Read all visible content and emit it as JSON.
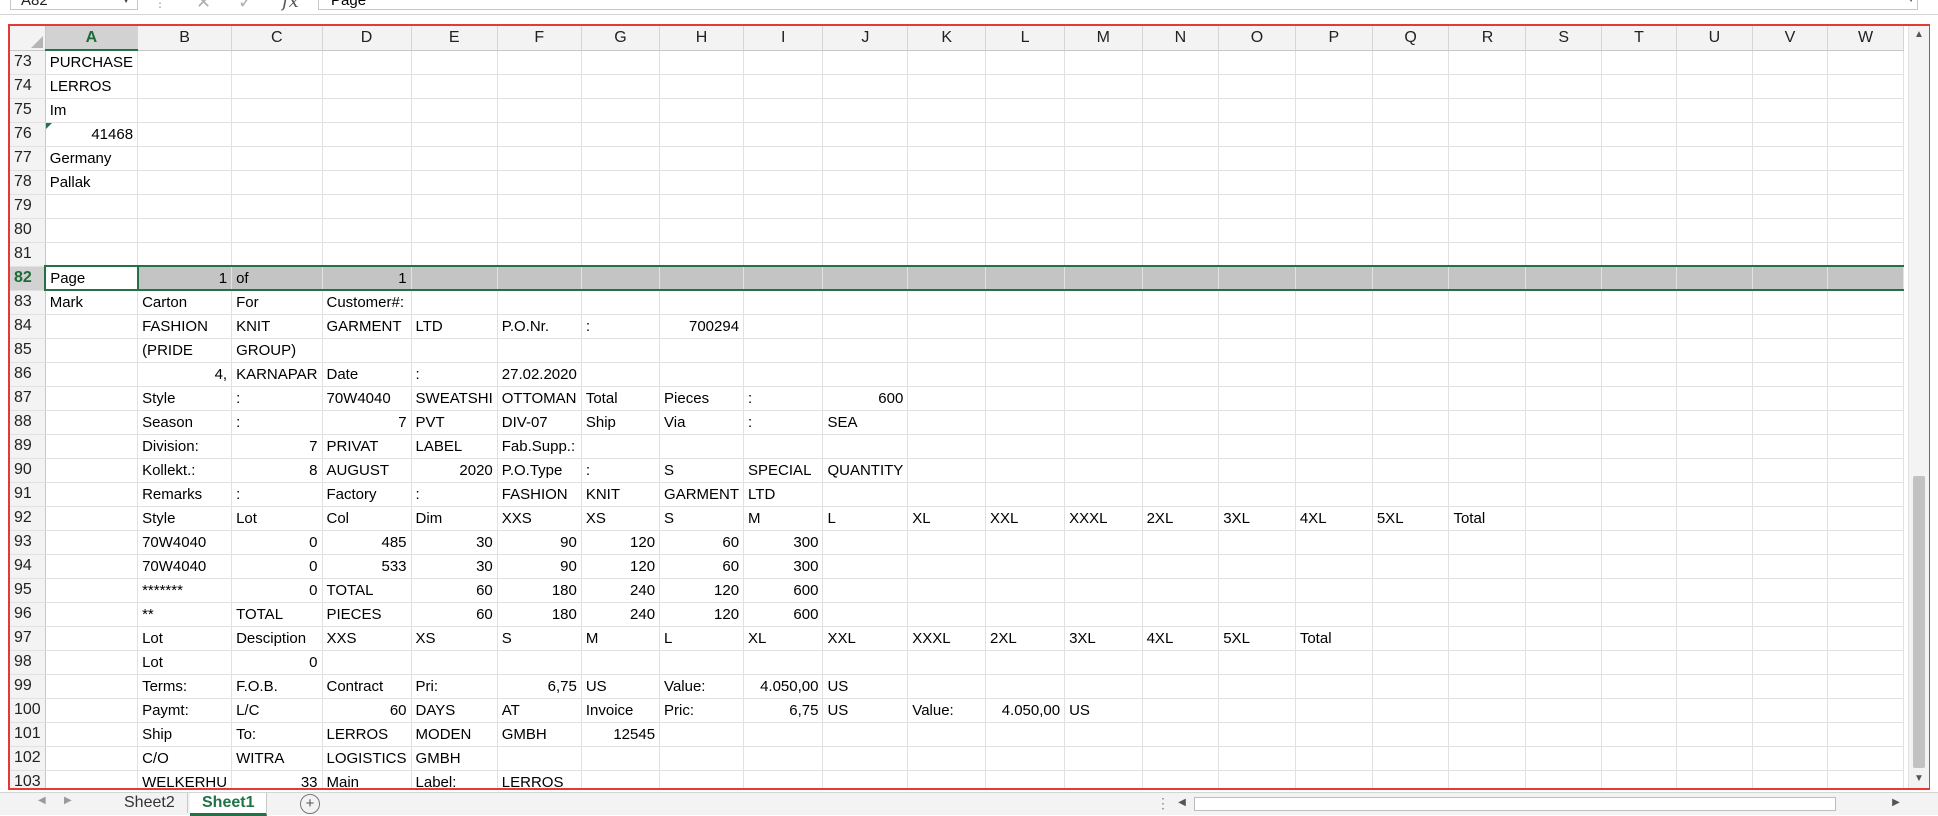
{
  "formula_bar": {
    "name_box": "A82",
    "formula": "Page"
  },
  "columns": [
    "A",
    "B",
    "C",
    "D",
    "E",
    "F",
    "G",
    "H",
    "I",
    "J",
    "K",
    "L",
    "M",
    "N",
    "O",
    "P",
    "Q",
    "R",
    "S",
    "T",
    "U",
    "V",
    "W"
  ],
  "selected_column": "A",
  "selected_row": "82",
  "rows": [
    {
      "n": "73",
      "cells": [
        "PURCHASE"
      ]
    },
    {
      "n": "74",
      "cells": [
        "LERROS"
      ]
    },
    {
      "n": "75",
      "cells": [
        "Im"
      ]
    },
    {
      "n": "76",
      "cells": [
        "41468"
      ]
    },
    {
      "n": "77",
      "cells": [
        "Germany"
      ]
    },
    {
      "n": "78",
      "cells": [
        "Pallak"
      ]
    },
    {
      "n": "79",
      "cells": []
    },
    {
      "n": "80",
      "cells": []
    },
    {
      "n": "81",
      "cells": []
    },
    {
      "n": "82",
      "cells": [
        "Page",
        "1",
        "of",
        "1"
      ]
    },
    {
      "n": "83",
      "cells": [
        "Mark",
        "Carton",
        "For",
        "Customer#:"
      ]
    },
    {
      "n": "84",
      "cells": [
        "",
        "FASHION",
        "KNIT",
        "GARMENT",
        "LTD",
        "P.O.Nr.",
        ":",
        "700294"
      ]
    },
    {
      "n": "85",
      "cells": [
        "",
        "(PRIDE",
        "GROUP)"
      ]
    },
    {
      "n": "86",
      "cells": [
        "",
        "4,",
        "KARNAPAR",
        "Date",
        ":",
        "27.02.2020"
      ]
    },
    {
      "n": "87",
      "cells": [
        "",
        "Style",
        ":",
        "70W4040",
        "SWEATSHI",
        "OTTOMAN",
        "Total",
        "Pieces",
        ":",
        "600"
      ]
    },
    {
      "n": "88",
      "cells": [
        "",
        "Season",
        ":",
        "7",
        "PVT",
        "DIV-07",
        "Ship",
        "Via",
        ":",
        "SEA"
      ]
    },
    {
      "n": "89",
      "cells": [
        "",
        "Division:",
        "7",
        "PRIVAT",
        "LABEL",
        "Fab.Supp.:"
      ]
    },
    {
      "n": "90",
      "cells": [
        "",
        "Kollekt.:",
        "8",
        "AUGUST",
        "2020",
        "P.O.Type",
        ":",
        "S",
        "SPECIAL",
        "QUANTITY"
      ]
    },
    {
      "n": "91",
      "cells": [
        "",
        "Remarks",
        ":",
        "Factory",
        ":",
        "FASHION",
        "KNIT",
        "GARMENT",
        "LTD"
      ]
    },
    {
      "n": "92",
      "cells": [
        "",
        "Style",
        "Lot",
        "Col",
        "Dim",
        "XXS",
        "XS",
        "S",
        "M",
        "L",
        "XL",
        "XXL",
        "XXXL",
        "2XL",
        "3XL",
        "4XL",
        "5XL",
        "Total"
      ]
    },
    {
      "n": "93",
      "cells": [
        "",
        "70W4040",
        "0",
        "485",
        "30",
        "90",
        "120",
        "60",
        "300"
      ]
    },
    {
      "n": "94",
      "cells": [
        "",
        "70W4040",
        "0",
        "533",
        "30",
        "90",
        "120",
        "60",
        "300"
      ]
    },
    {
      "n": "95",
      "cells": [
        "",
        "*******",
        "0",
        "TOTAL",
        "60",
        "180",
        "240",
        "120",
        "600"
      ]
    },
    {
      "n": "96",
      "cells": [
        "",
        "**",
        "TOTAL",
        "PIECES",
        "60",
        "180",
        "240",
        "120",
        "600"
      ]
    },
    {
      "n": "97",
      "cells": [
        "",
        "Lot",
        "Desciption",
        "XXS",
        "XS",
        "S",
        "M",
        "L",
        "XL",
        "XXL",
        "XXXL",
        "2XL",
        "3XL",
        "4XL",
        "5XL",
        "Total"
      ]
    },
    {
      "n": "98",
      "cells": [
        "",
        "Lot",
        "0"
      ]
    },
    {
      "n": "99",
      "cells": [
        "",
        "Terms:",
        "F.O.B.",
        "Contract",
        "Pri:",
        "6,75",
        "US",
        "Value:",
        "4.050,00",
        "US"
      ]
    },
    {
      "n": "100",
      "cells": [
        "",
        "Paymt:",
        "L/C",
        "60",
        "DAYS",
        "AT",
        "Invoice",
        "Pric:",
        "6,75",
        "US",
        "Value:",
        "4.050,00",
        "US"
      ]
    },
    {
      "n": "101",
      "cells": [
        "",
        "Ship",
        "To:",
        "LERROS",
        "MODEN",
        "GMBH",
        "12545"
      ]
    },
    {
      "n": "102",
      "cells": [
        "",
        "C/O",
        "WITRA",
        "LOGISTICS",
        "GMBH"
      ]
    },
    {
      "n": "103",
      "cells": [
        "",
        "WELKERHU",
        "33",
        "Main",
        "Label:",
        "LERROS"
      ]
    }
  ],
  "sheet_tabs": [
    {
      "label": "Sheet2",
      "active": false
    },
    {
      "label": "Sheet1",
      "active": true
    }
  ],
  "colors": {
    "excel_green": "#217346",
    "selection_gray": "#c4c4c4",
    "frame_red": "#e53935"
  }
}
